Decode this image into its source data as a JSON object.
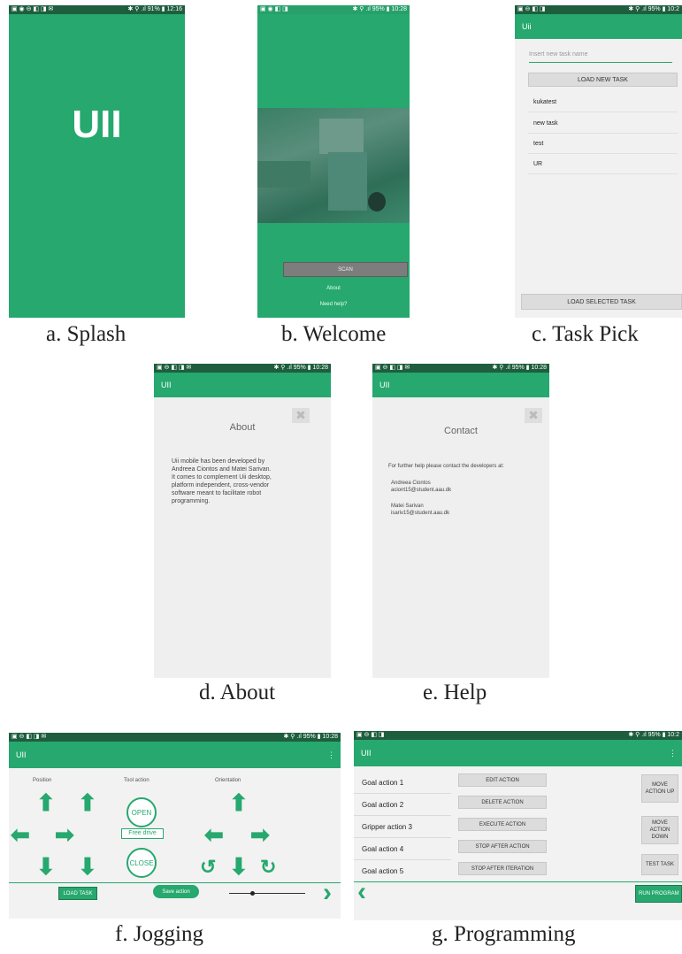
{
  "splash": {
    "status_left": "▣ ◉ ⊖ ◧ ◨ ✉",
    "status_right": "✱ ⚲ .ıl 91% ▮ 12:16",
    "logo": "UII",
    "caption": "a. Splash"
  },
  "welcome": {
    "status_left": "▣ ◉ ◧ ◨",
    "status_right": "✱ ⚲ .ıl 95% ▮ 10:28",
    "scan": "SCAN",
    "about": "About",
    "need_help": "Need help?",
    "caption": "b. Welcome"
  },
  "taskpick": {
    "status_left": "▣ ⊖ ◧ ◨",
    "status_right": "✱ ⚲ .ıl 95% ▮ 10:2",
    "app_title": "Uii",
    "placeholder": "Insert new task name",
    "load_new": "LOAD NEW TASK",
    "tasks": [
      "kukatest",
      "new task",
      "test",
      "UR"
    ],
    "load_selected": "LOAD SELECTED TASK",
    "caption": "c. Task Pick"
  },
  "about": {
    "status_left": "▣ ⊖ ◧ ◨ ✉",
    "status_right": "✱ ⚲ .ıl 95% ▮ 10:28",
    "app_title": "UII",
    "title": "About",
    "close": "✖",
    "lines": [
      "Uii mobile has been developed by",
      "Andreea Ciontos and Matei Sarivan.",
      "It comes to complement Uii desktop,",
      "platform independent, cross-vendor",
      "software meant to facilitate robot",
      "programming."
    ],
    "caption": "d. About"
  },
  "help": {
    "status_left": "▣ ⊖ ◧ ◨ ✉",
    "status_right": "✱ ⚲ .ıl 95% ▮ 10:28",
    "app_title": "UII",
    "title": "Contact",
    "close": "✖",
    "intro": "For further help please contact the developers at:",
    "dev1_name": "Andreea Ciontos",
    "dev1_email": "aciont15@student.aau.dk",
    "dev2_name": "Matei Sarivan",
    "dev2_email": "isariv15@student.aau.dk",
    "caption": "e. Help"
  },
  "jogging": {
    "status_left": "▣ ⊖ ◧ ◨ ✉",
    "status_right": "✱ ⚲ .ıl 95% ▮ 10:28",
    "app_title": "UII",
    "menu": "⋮",
    "position": "Position",
    "tool_action": "Tool action",
    "orientation": "Orientation",
    "open": "OPEN",
    "free_drive": "Free drive",
    "close": "CLOSE",
    "load_task": "LOAD TASK",
    "save_action": "Save action",
    "next": "›",
    "slider_value": 0.3,
    "caption": "f. Jogging"
  },
  "programming": {
    "status_left": "▣ ⊖ ◧ ◨",
    "status_right": "✱ ⚲ .ıl 95% ▮ 10:2",
    "app_title": "UII",
    "menu": "⋮",
    "goals": [
      "Goal action 1",
      "Goal action 2",
      "Gripper action 3",
      "Goal action 4",
      "Goal action 5"
    ],
    "actions": [
      "EDIT ACTION",
      "DELETE ACTION",
      "EXECUTE ACTION",
      "STOP AFTER ACTION",
      "STOP AFTER ITERATION"
    ],
    "move_up": "MOVE ACTION UP",
    "move_down": "MOVE ACTION DOWN",
    "test_task": "TEST TASK",
    "prev": "‹",
    "run_program": "RUN PROGRAM",
    "caption": "g. Programming"
  },
  "colors": {
    "accent": "#26a86e",
    "status_bar": "#1e5e3e",
    "panel_bg": "#efefef"
  }
}
